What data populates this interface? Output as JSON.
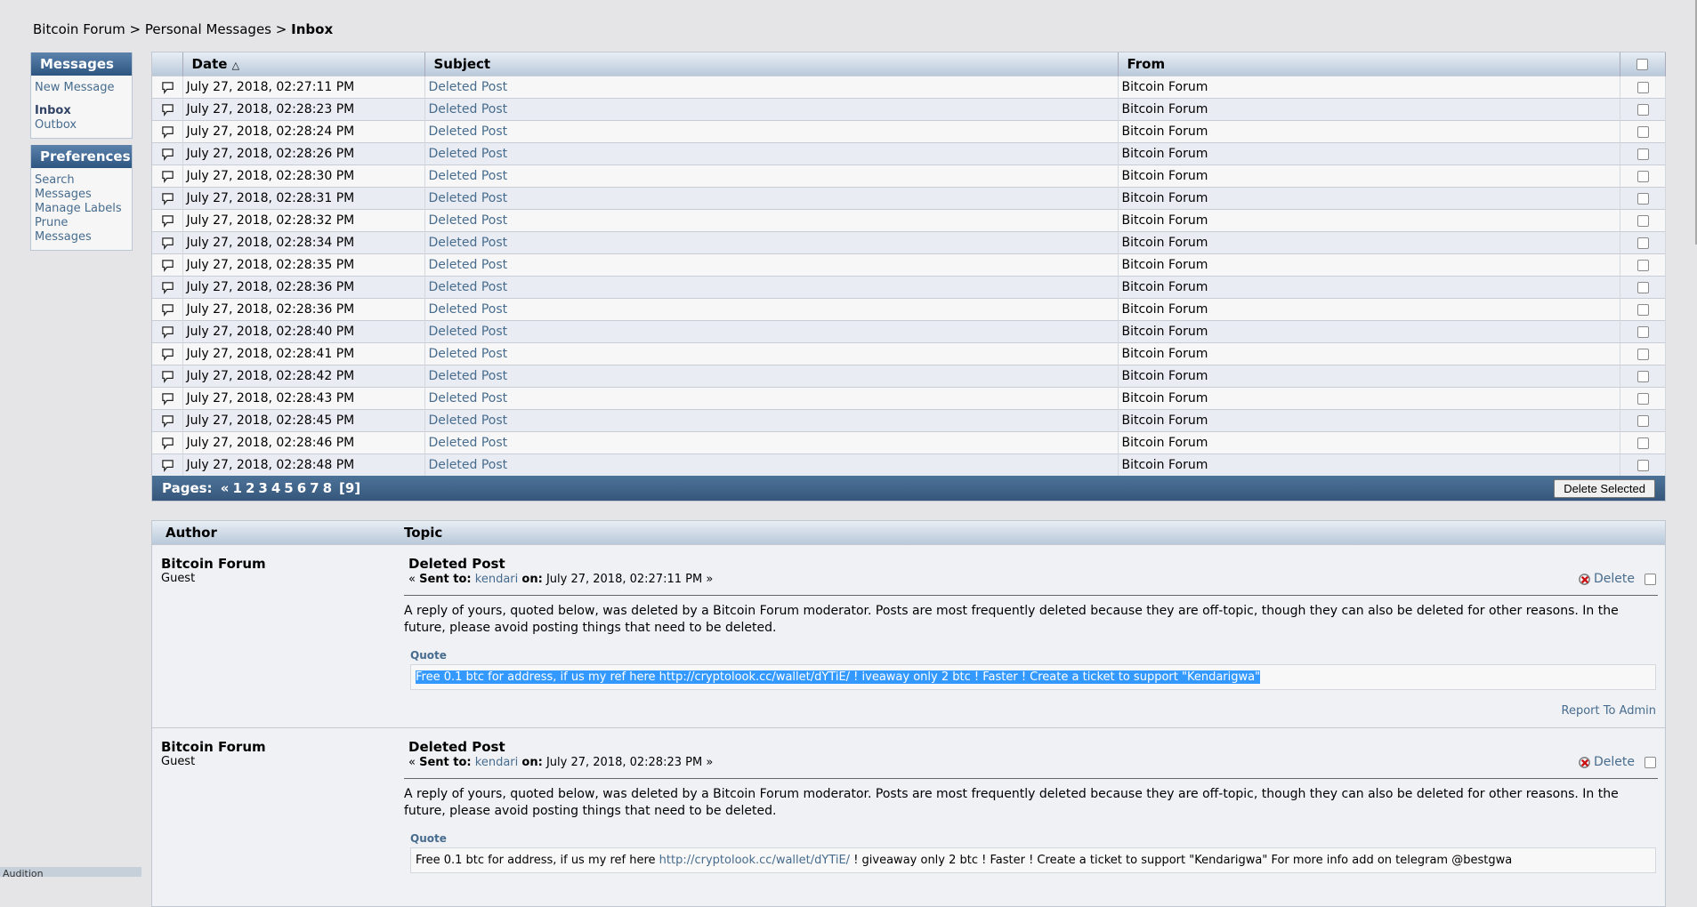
{
  "breadcrumb": {
    "forum": "Bitcoin Forum",
    "sep": ">",
    "pm": "Personal Messages",
    "current": "Inbox"
  },
  "sidebar": {
    "messages_title": "Messages",
    "new_message": "New Message",
    "inbox": "Inbox",
    "outbox": "Outbox",
    "prefs_title": "Preferences",
    "search": "Search Messages",
    "manage_labels": "Manage Labels",
    "prune": "Prune Messages"
  },
  "inbox": {
    "columns": {
      "date": "Date",
      "subject": "Subject",
      "from": "From"
    },
    "rows": [
      {
        "date": "July 27, 2018, 02:27:11 PM",
        "subject": "Deleted Post",
        "from": "Bitcoin Forum"
      },
      {
        "date": "July 27, 2018, 02:28:23 PM",
        "subject": "Deleted Post",
        "from": "Bitcoin Forum"
      },
      {
        "date": "July 27, 2018, 02:28:24 PM",
        "subject": "Deleted Post",
        "from": "Bitcoin Forum"
      },
      {
        "date": "July 27, 2018, 02:28:26 PM",
        "subject": "Deleted Post",
        "from": "Bitcoin Forum"
      },
      {
        "date": "July 27, 2018, 02:28:30 PM",
        "subject": "Deleted Post",
        "from": "Bitcoin Forum"
      },
      {
        "date": "July 27, 2018, 02:28:31 PM",
        "subject": "Deleted Post",
        "from": "Bitcoin Forum"
      },
      {
        "date": "July 27, 2018, 02:28:32 PM",
        "subject": "Deleted Post",
        "from": "Bitcoin Forum"
      },
      {
        "date": "July 27, 2018, 02:28:34 PM",
        "subject": "Deleted Post",
        "from": "Bitcoin Forum"
      },
      {
        "date": "July 27, 2018, 02:28:35 PM",
        "subject": "Deleted Post",
        "from": "Bitcoin Forum"
      },
      {
        "date": "July 27, 2018, 02:28:36 PM",
        "subject": "Deleted Post",
        "from": "Bitcoin Forum"
      },
      {
        "date": "July 27, 2018, 02:28:36 PM",
        "subject": "Deleted Post",
        "from": "Bitcoin Forum"
      },
      {
        "date": "July 27, 2018, 02:28:40 PM",
        "subject": "Deleted Post",
        "from": "Bitcoin Forum"
      },
      {
        "date": "July 27, 2018, 02:28:41 PM",
        "subject": "Deleted Post",
        "from": "Bitcoin Forum"
      },
      {
        "date": "July 27, 2018, 02:28:42 PM",
        "subject": "Deleted Post",
        "from": "Bitcoin Forum"
      },
      {
        "date": "July 27, 2018, 02:28:43 PM",
        "subject": "Deleted Post",
        "from": "Bitcoin Forum"
      },
      {
        "date": "July 27, 2018, 02:28:45 PM",
        "subject": "Deleted Post",
        "from": "Bitcoin Forum"
      },
      {
        "date": "July 27, 2018, 02:28:46 PM",
        "subject": "Deleted Post",
        "from": "Bitcoin Forum"
      },
      {
        "date": "July 27, 2018, 02:28:48 PM",
        "subject": "Deleted Post",
        "from": "Bitcoin Forum"
      }
    ]
  },
  "pagination": {
    "label": "Pages:",
    "prev": "«",
    "pages": [
      "1",
      "2",
      "3",
      "4",
      "5",
      "6",
      "7",
      "8"
    ],
    "current": "[9]"
  },
  "delete_selected": "Delete Selected",
  "posts_header": {
    "author": "Author",
    "topic": "Topic"
  },
  "posts": [
    {
      "author": "Bitcoin Forum",
      "role": "Guest",
      "title": "Deleted Post",
      "meta_prefix": "«",
      "sent_to_label": "Sent to:",
      "recipient": "kendari",
      "on_label": "on:",
      "date": "July 27, 2018, 02:27:11 PM",
      "meta_suffix": "»",
      "delete": "Delete",
      "body": "A reply of yours, quoted below, was deleted by a Bitcoin Forum moderator. Posts are most frequently deleted because they are off-topic, though they can also be deleted for other reasons. In the future, please avoid posting things that need to be deleted.",
      "quote_label": "Quote",
      "quote": "Free 0.1 btc for address, if us my ref here http://cryptolook.cc/wallet/dYTiE/  ! iveaway only 2 btc ! Faster ! Create a ticket to support \"Kendarigwa\"",
      "report": "Report To Admin"
    },
    {
      "author": "Bitcoin Forum",
      "role": "Guest",
      "title": "Deleted Post",
      "meta_prefix": "«",
      "sent_to_label": "Sent to:",
      "recipient": "kendari",
      "on_label": "on:",
      "date": "July 27, 2018, 02:28:23 PM",
      "meta_suffix": "»",
      "delete": "Delete",
      "body": "A reply of yours, quoted below, was deleted by a Bitcoin Forum moderator. Posts are most frequently deleted because they are off-topic, though they can also be deleted for other reasons. In the future, please avoid posting things that need to be deleted.",
      "quote_label": "Quote",
      "quote_pre": "Free 0.1 btc for address, if us my ref here ",
      "quote_link": "http://cryptolook.cc/wallet/dYTiE/",
      "quote_post": "  ! giveaway only 2 btc ! Faster ! Create a ticket to support \"Kendarigwa\" For more info add on telegram @bestgwa"
    }
  ],
  "taskbar": "Audition"
}
